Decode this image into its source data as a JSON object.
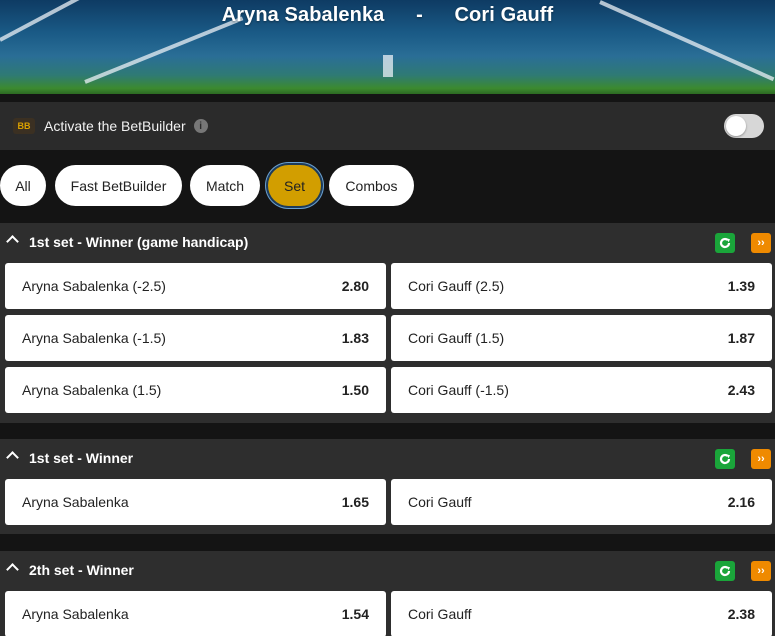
{
  "header": {
    "home": "Aryna Sabalenka",
    "separator": "-",
    "away": "Cori Gauff"
  },
  "betbuilder": {
    "badge": "BB",
    "label": "Activate the BetBuilder",
    "info": "i",
    "enabled": false
  },
  "tabs": [
    {
      "label": "All",
      "active": false
    },
    {
      "label": "Fast BetBuilder",
      "active": false
    },
    {
      "label": "Match",
      "active": false
    },
    {
      "label": "Set",
      "active": true
    },
    {
      "label": "Combos",
      "active": false
    }
  ],
  "markets": [
    {
      "title": "1st set - Winner (game handicap)",
      "rows": [
        [
          {
            "selection": "Aryna Sabalenka (-2.5)",
            "odds": "2.80"
          },
          {
            "selection": "Cori Gauff (2.5)",
            "odds": "1.39"
          }
        ],
        [
          {
            "selection": "Aryna Sabalenka (-1.5)",
            "odds": "1.83"
          },
          {
            "selection": "Cori Gauff (1.5)",
            "odds": "1.87"
          }
        ],
        [
          {
            "selection": "Aryna Sabalenka (1.5)",
            "odds": "1.50"
          },
          {
            "selection": "Cori Gauff (-1.5)",
            "odds": "2.43"
          }
        ]
      ]
    },
    {
      "title": "1st set - Winner",
      "rows": [
        [
          {
            "selection": "Aryna Sabalenka",
            "odds": "1.65"
          },
          {
            "selection": "Cori Gauff",
            "odds": "2.16"
          }
        ]
      ]
    },
    {
      "title": "2th set - Winner",
      "rows": [
        [
          {
            "selection": "Aryna Sabalenka",
            "odds": "1.54"
          },
          {
            "selection": "Cori Gauff",
            "odds": "2.38"
          }
        ]
      ]
    }
  ],
  "icons": {
    "collapse": "chevron-up-icon",
    "cashout": "refresh-icon",
    "more": "double-chevron-right-icon"
  },
  "colors": {
    "accent": "#d29e00",
    "green": "#1aa53a",
    "orange": "#ef8a00",
    "panel": "#2e2e2e",
    "background": "#141414"
  }
}
